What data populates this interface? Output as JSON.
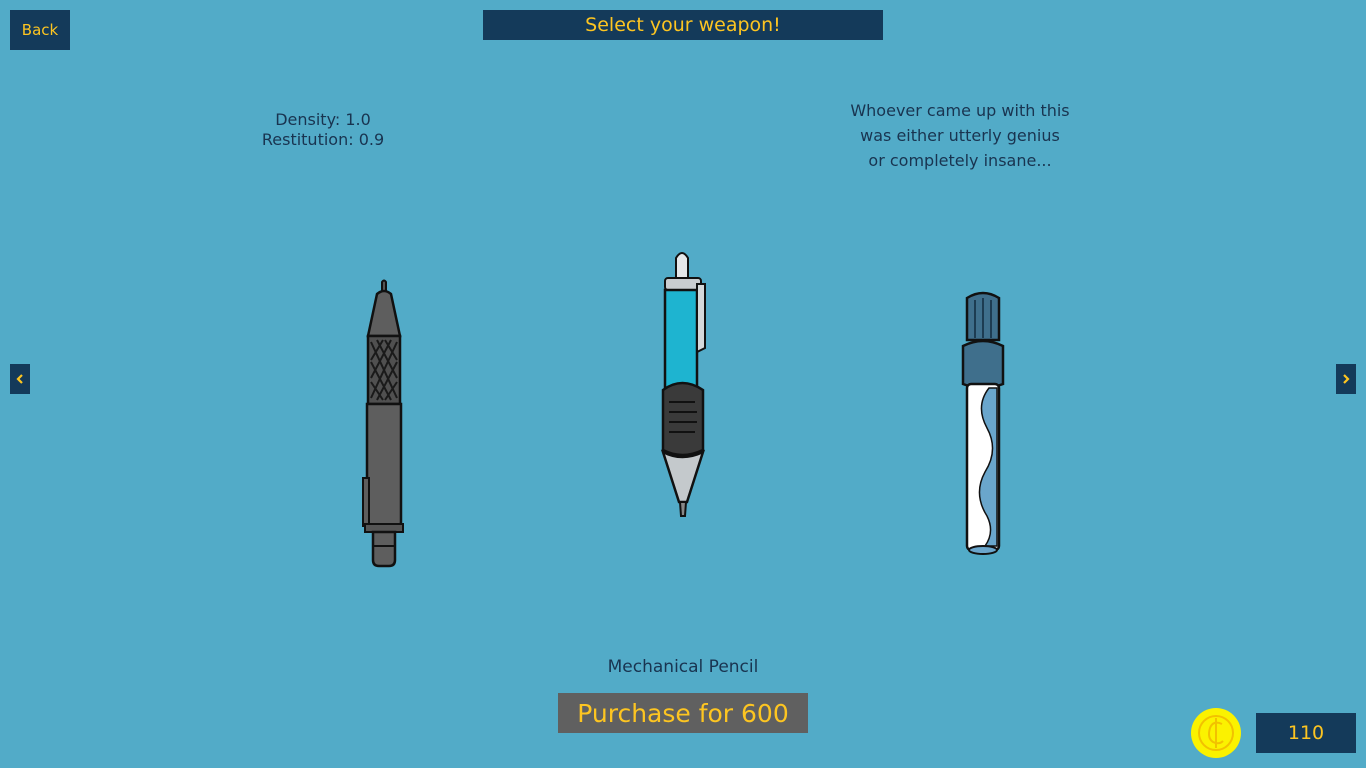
{
  "colors": {
    "background": "#52abc8",
    "panel": "#143a5a",
    "accent": "#fdc521",
    "text": "#193450",
    "button": "#606060",
    "coin": "#fbf200"
  },
  "header": {
    "back_label": "Back",
    "title": "Select your weapon!"
  },
  "nav": {
    "left_icon": "chevron-left-icon",
    "right_icon": "chevron-right-icon"
  },
  "stats": {
    "density": "Density: 1.0",
    "restitution": "Restitution: 0.9"
  },
  "quote": {
    "line1": "Whoever came up with this",
    "line2": "was either utterly genius",
    "line3": "or completely insane..."
  },
  "weapons": {
    "left_icon": "mechanical-pencil-icon",
    "center_icon": "ballpoint-pen-icon",
    "right_icon": "marker-icon"
  },
  "selected": {
    "name": "Mechanical Pencil",
    "purchase_label": "Purchase for 600"
  },
  "currency": {
    "icon": "coin-icon",
    "count": "110"
  }
}
